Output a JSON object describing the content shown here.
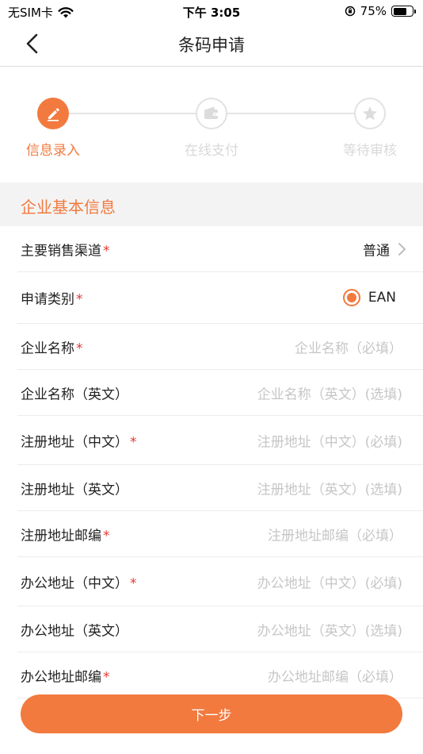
{
  "status_bar": {
    "carrier": "无SIM卡",
    "time": "下午 3:05",
    "battery_text": "75%",
    "battery_level": 0.75
  },
  "nav": {
    "title": "条码申请",
    "back_icon": "chevron-left-icon"
  },
  "stepper": {
    "steps": [
      {
        "label": "信息录入",
        "icon": "pencil-icon",
        "active": true
      },
      {
        "label": "在线支付",
        "icon": "wallet-icon",
        "active": false
      },
      {
        "label": "等待审核",
        "icon": "star-icon",
        "active": false
      }
    ]
  },
  "section": {
    "title": "企业基本信息"
  },
  "form": {
    "rows": [
      {
        "label": "主要销售渠道",
        "required": "*",
        "value": "普通"
      },
      {
        "label": "申请类别",
        "required": "*",
        "radio_label": "EAN"
      },
      {
        "label": "企业名称",
        "required": "*",
        "placeholder": "企业名称（必填）"
      },
      {
        "label": "企业名称（英文）",
        "required": "",
        "placeholder": "企业名称（英文）(选填)"
      },
      {
        "label": "注册地址（中文）",
        "required": "*",
        "placeholder": "注册地址（中文）(必填)"
      },
      {
        "label": "注册地址（英文）",
        "required": "",
        "placeholder": "注册地址（英文）(选填)"
      },
      {
        "label": "注册地址邮编",
        "required": "*",
        "placeholder": "注册地址邮编（必填）"
      },
      {
        "label": "办公地址（中文）",
        "required": "*",
        "placeholder": "办公地址（中文）(必填)"
      },
      {
        "label": "办公地址（英文）",
        "required": "",
        "placeholder": "办公地址（英文）(选填)"
      },
      {
        "label": "办公地址邮编",
        "required": "*",
        "placeholder": "办公地址邮编（必填）"
      }
    ]
  },
  "footer": {
    "next_label": "下一步"
  },
  "colors": {
    "accent": "#f27a3f",
    "required": "#e53935",
    "placeholder": "#c6c6c6"
  }
}
